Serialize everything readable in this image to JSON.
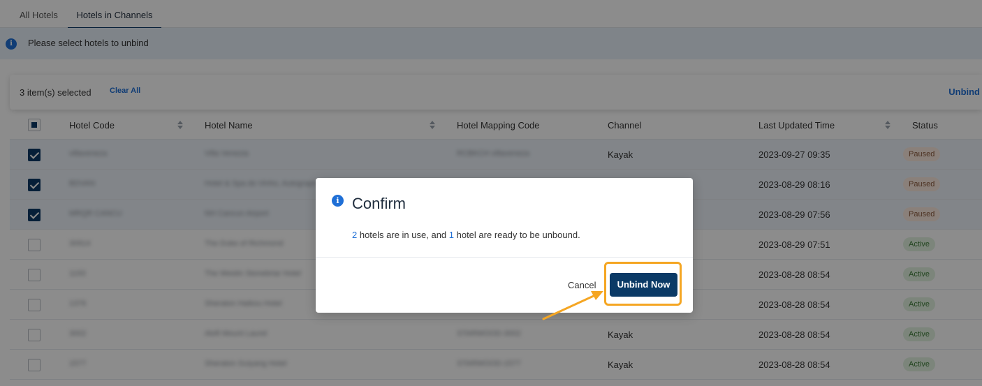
{
  "tabs": [
    {
      "label": "All Hotels"
    },
    {
      "label": "Hotels in Channels"
    }
  ],
  "notice": {
    "text": "Please select hotels to unbind",
    "icon": "info-icon"
  },
  "selection_bar": {
    "count_text": "3 item(s) selected",
    "clear_label": "Clear All",
    "unbind_label": "Unbind"
  },
  "table": {
    "headers": {
      "hotel_code": "Hotel Code",
      "hotel_name": "Hotel Name",
      "mapping_code": "Hotel Mapping Code",
      "channel": "Channel",
      "last_updated": "Last Updated Time",
      "status": "Status"
    },
    "rows": [
      {
        "code": "villaveneza",
        "name": "Villa Venezia",
        "mapping": "RCBKCH villaveneza",
        "channel": "Kayak",
        "updated": "2023-09-27 09:35",
        "status": "Paused"
      },
      {
        "code": "BDVAN",
        "name": "Hotel & Spa do Vinho, Autograph",
        "mapping": "",
        "channel": "",
        "updated": "2023-08-29 08:16",
        "status": "Paused"
      },
      {
        "code": "MRQR CANCU",
        "name": "NH Cancun Airport",
        "mapping": "",
        "channel": "",
        "updated": "2023-08-29 07:56",
        "status": "Paused"
      },
      {
        "code": "30914",
        "name": "The Duke of Richmond",
        "mapping": "",
        "channel": "",
        "updated": "2023-08-29 07:51",
        "status": "Active"
      },
      {
        "code": "1193",
        "name": "The Westin Stonebriar Hotel",
        "mapping": "",
        "channel": "",
        "updated": "2023-08-28 08:54",
        "status": "Active"
      },
      {
        "code": "1376",
        "name": "Sheraton Haikou Hotel",
        "mapping": "",
        "channel": "",
        "updated": "2023-08-28 08:54",
        "status": "Active"
      },
      {
        "code": "3002",
        "name": "Aloft Mount Laurel",
        "mapping": "STARWOOD-3002",
        "channel": "Kayak",
        "updated": "2023-08-28 08:54",
        "status": "Active"
      },
      {
        "code": "1577",
        "name": "Sheraton Guiyang Hotel",
        "mapping": "STARWOOD-1577",
        "channel": "Kayak",
        "updated": "2023-08-28 08:54",
        "status": "Active"
      }
    ]
  },
  "modal": {
    "title": "Confirm",
    "in_use_count": "2",
    "in_use_text": " hotels are in use, and ",
    "ready_count": "1",
    "ready_text": " hotel are ready to be unbound.",
    "cancel_label": "Cancel",
    "confirm_label": "Unbind Now"
  },
  "colors": {
    "primary": "#0b3a66",
    "accent": "#1f6fd6",
    "highlight": "#f5a623"
  }
}
